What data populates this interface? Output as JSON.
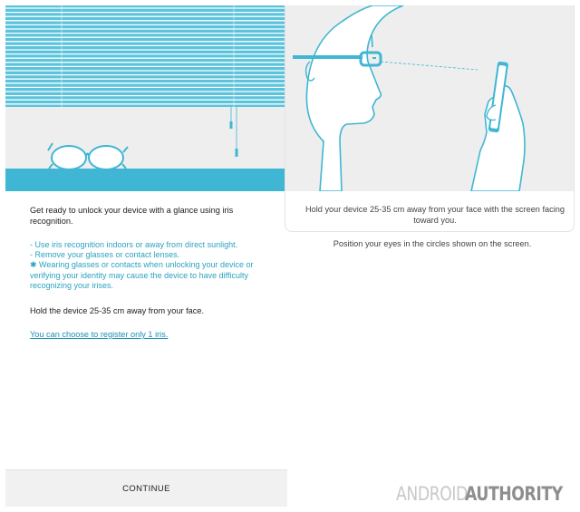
{
  "left_screen": {
    "intro": "Get ready to unlock your device with a glance using iris recognition.",
    "tips": [
      "- Use iris recognition indoors or away from direct sunlight.",
      "- Remove your glasses or contact lenses.",
      "✱ Wearing glasses or contacts when unlocking your device or verifying your identity may cause the device to have difficulty recognizing your irises."
    ],
    "hold": "Hold the device 25-35 cm away from your face.",
    "register_link": "You can choose to register only 1 iris.",
    "continue_label": "CONTINUE"
  },
  "right_screen": {
    "instruction_1": "Hold your device 25-35 cm away from your face with the screen facing toward you.",
    "instruction_2": "Position your eyes in the circles shown on the screen."
  },
  "watermark": {
    "part1": "ANDROID",
    "part2": "AUTHORITY"
  },
  "colors": {
    "accent": "#3fb6d3",
    "blind": "#5cc3dc",
    "link": "#1a8fb4",
    "tip_text": "#2aa2c1"
  }
}
